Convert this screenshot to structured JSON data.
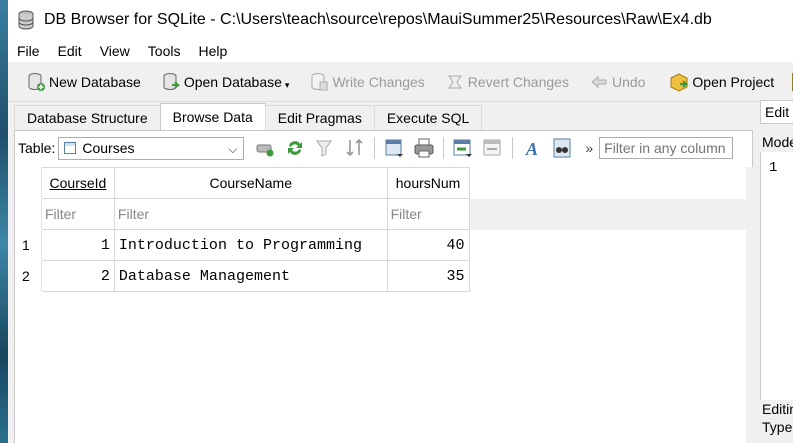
{
  "window": {
    "title": "DB Browser for SQLite - C:\\Users\\teach\\source\\repos\\MauiSummer25\\Resources\\Raw\\Ex4.db"
  },
  "menu": [
    "File",
    "Edit",
    "View",
    "Tools",
    "Help"
  ],
  "toolbar": {
    "new_database": "New Database",
    "open_database": "Open Database",
    "write_changes": "Write Changes",
    "revert_changes": "Revert Changes",
    "undo": "Undo",
    "open_project": "Open Project"
  },
  "tabs": [
    "Database Structure",
    "Browse Data",
    "Edit Pragmas",
    "Execute SQL"
  ],
  "browse": {
    "table_label": "Table:",
    "table_selected": "Courses",
    "more": "»",
    "filter_any_placeholder": "Filter in any column"
  },
  "grid": {
    "columns": [
      "CourseId",
      "CourseName",
      "hoursNum"
    ],
    "filter_placeholder": "Filter",
    "rows": [
      {
        "num": "1",
        "id": "1",
        "name": "Introduction to Programming",
        "hours": "40"
      },
      {
        "num": "2",
        "id": "2",
        "name": "Database Management",
        "hours": "35"
      }
    ]
  },
  "right_pane": {
    "tab": "Edit",
    "mode": "Mode",
    "line": "1",
    "editing": "Editin",
    "type": "Type"
  }
}
